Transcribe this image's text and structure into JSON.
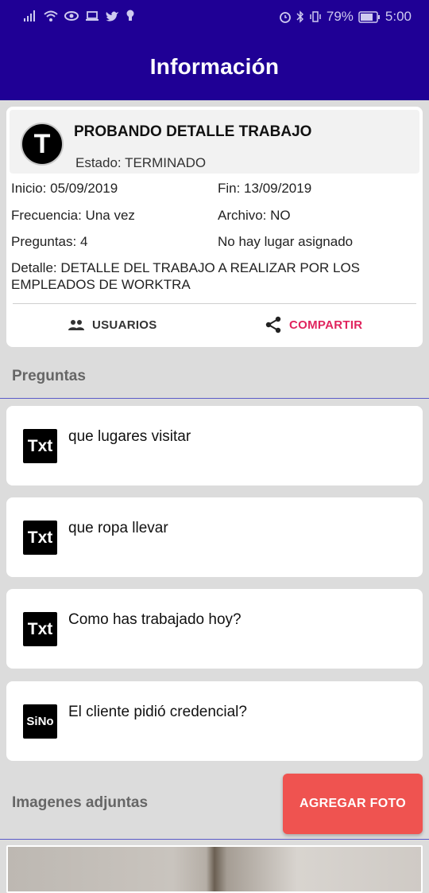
{
  "status_bar": {
    "battery": "79%",
    "time": "5:00"
  },
  "app_bar": {
    "title": "Información"
  },
  "job": {
    "avatar_letter": "T",
    "title": "PROBANDO DETALLE TRABAJO",
    "state": "Estado: TERMINADO",
    "start": "Inicio: 05/09/2019",
    "end": "Fin: 13/09/2019",
    "frequency": "Frecuencia: Una vez",
    "archived": "Archivo: NO",
    "questions_count": "Preguntas: 4",
    "place": "No hay lugar asignado",
    "detail": "Detalle: DETALLE DEL TRABAJO A REALIZAR POR LOS EMPLEADOS DE WORKTRA"
  },
  "actions": {
    "users_label": "USUARIOS",
    "share_label": "COMPARTIR"
  },
  "questions_section": {
    "title": "Preguntas",
    "items": [
      {
        "type": "Txt",
        "text": "que lugares visitar"
      },
      {
        "type": "Txt",
        "text": "que ropa llevar"
      },
      {
        "type": "Txt",
        "text": "Como has trabajado hoy?"
      },
      {
        "type": "SiNo",
        "text": "El cliente pidió credencial?"
      }
    ]
  },
  "images_section": {
    "title": "Imagenes adjuntas",
    "add_button_label": "AGREGAR FOTO"
  },
  "colors": {
    "app_bar": "#1f0095",
    "accent_share": "#e0245e",
    "add_photo_button": "#ef5350"
  }
}
